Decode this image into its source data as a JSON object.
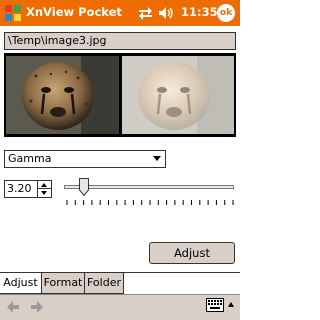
{
  "titlebar": {
    "app_title": "XnView Pocket",
    "clock": "11:35",
    "ok_label": "ok",
    "accent_color": "#ef6c00",
    "icons": [
      "windows-start-icon",
      "network-icon",
      "volume-icon"
    ]
  },
  "main": {
    "path": "\\Temp\\image3.jpg",
    "preview": {
      "left_image": "cheetah photo (original)",
      "right_image": "cheetah photo (adjusted, brightened)"
    },
    "filter_select": {
      "selected": "Gamma"
    },
    "value_field": {
      "value": "3.20"
    },
    "slider": {
      "level": 0.12
    },
    "adjust_button_label": "Adjust"
  },
  "tabs": [
    {
      "label": "Adjust",
      "active": true
    },
    {
      "label": "Format",
      "active": false
    },
    {
      "label": "Folder",
      "active": false
    }
  ],
  "bottombar": {
    "icons": [
      "back-arrow-icon",
      "forward-arrow-icon",
      "keyboard-icon"
    ]
  }
}
